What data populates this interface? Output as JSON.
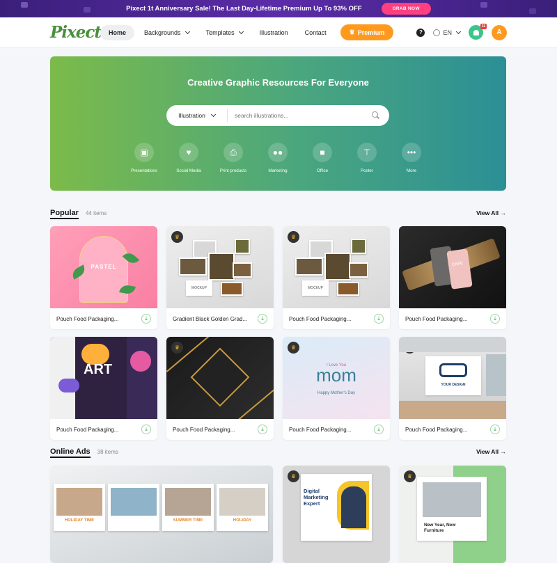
{
  "promo": {
    "text": "Pixect 1t Anniversary Sale! The Last Day-Lifetime Premium Up To 93% OFF",
    "button": "GRAB NOW"
  },
  "header": {
    "logo": "Pixect",
    "nav": {
      "home": "Home",
      "backgrounds": "Backgrounds",
      "templates": "Templates",
      "illustration": "Illustration",
      "contact": "Contact",
      "premium": "Premium"
    },
    "help": "?",
    "language": "EN",
    "notification_count": "11",
    "avatar_initial": "A"
  },
  "hero": {
    "title": "Creative Graphic Resources For Everyone",
    "search_category": "Illustration",
    "search_placeholder": "search illustrations...",
    "categories": [
      "Presentations",
      "Social Media",
      "Print products",
      "Marketing",
      "Office",
      "Poster",
      "More"
    ]
  },
  "popular": {
    "title": "Popular",
    "count": "44 items",
    "view_all": "View All",
    "cards": [
      {
        "title": "Pouch Food Packaging...",
        "thumb_text": "PASTEL"
      },
      {
        "title": "Gradient Black Golden Grad...",
        "thumb_text": "MOCKUP"
      },
      {
        "title": "Pouch Food Packaging...",
        "thumb_text": "MOCKUP"
      },
      {
        "title": "Pouch Food Packaging...",
        "thumb_text": "CAFE"
      },
      {
        "title": "Pouch Food Packaging...",
        "thumb_text": "ART"
      },
      {
        "title": "Pouch Food Packaging..."
      },
      {
        "title": "Pouch Food Packaging...",
        "thumb_text": "mom",
        "thumb_small_top": "I Love You",
        "thumb_small_bottom": "Happy Mother's Day"
      },
      {
        "title": "Pouch Food Packaging...",
        "thumb_text": "YOUR DESIGN"
      }
    ]
  },
  "online_ads": {
    "title": "Online Ads",
    "count": "38 items",
    "view_all": "View All",
    "cards": [
      {
        "thumb_labels": [
          "HOLIDAY TIME",
          "",
          "SUMMER TIME",
          "HOLIDAY"
        ]
      },
      {
        "thumb_text": "Digital Marketing Expert"
      },
      {
        "thumb_text": "New Year, New Furniture"
      }
    ]
  }
}
